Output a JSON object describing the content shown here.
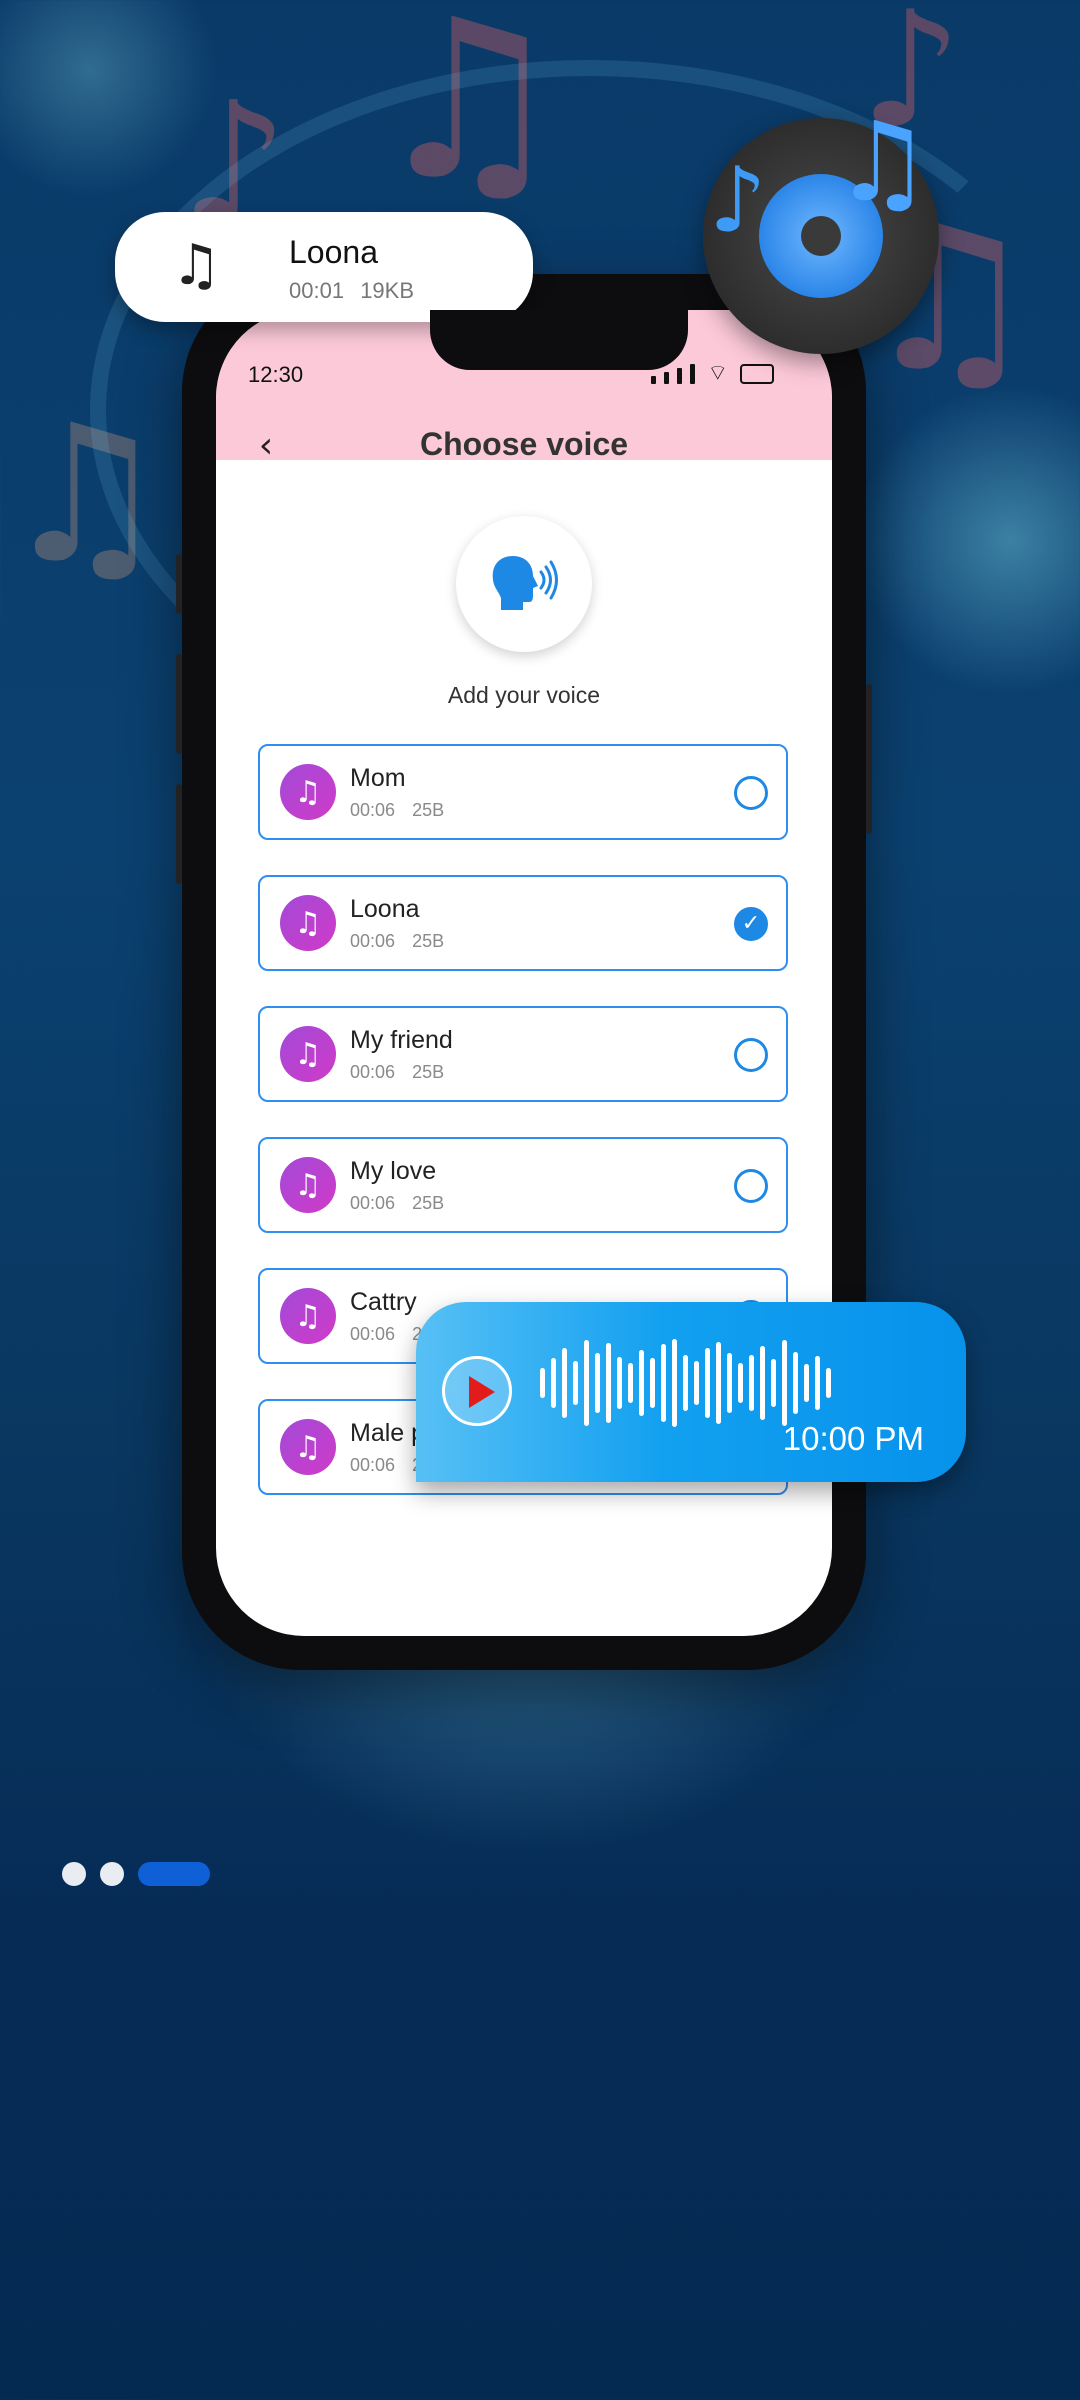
{
  "statusbar": {
    "time": "12:30"
  },
  "header": {
    "title": "Choose voice",
    "back_icon": "chevron-left-icon"
  },
  "add_voice": {
    "label": "Add your voice",
    "icon": "speaking-head-icon"
  },
  "voices": [
    {
      "name": "Mom",
      "duration": "00:06",
      "size": "25B",
      "selected": false
    },
    {
      "name": "Loona",
      "duration": "00:06",
      "size": "25B",
      "selected": true
    },
    {
      "name": "My friend",
      "duration": "00:06",
      "size": "25B",
      "selected": false
    },
    {
      "name": "My love",
      "duration": "00:06",
      "size": "25B",
      "selected": false
    },
    {
      "name": "Cattry",
      "duration": "00:06",
      "size": "25B",
      "selected": false
    },
    {
      "name": "Male p",
      "duration": "00:06",
      "size": "2",
      "selected": false
    }
  ],
  "now_playing_card": {
    "name": "Loona",
    "duration": "00:01",
    "size": "19KB",
    "icon": "music-note-icon"
  },
  "voice_message": {
    "time": "10:00 PM",
    "icon": "play-icon"
  },
  "pagination": {
    "count": 3,
    "active_index": 2
  },
  "colors": {
    "header_bg": "#fcc9d9",
    "accent": "#1e88e5",
    "avatar": "#b444d2",
    "background": "#0a3a68",
    "pager_active": "#0f5fd6"
  }
}
